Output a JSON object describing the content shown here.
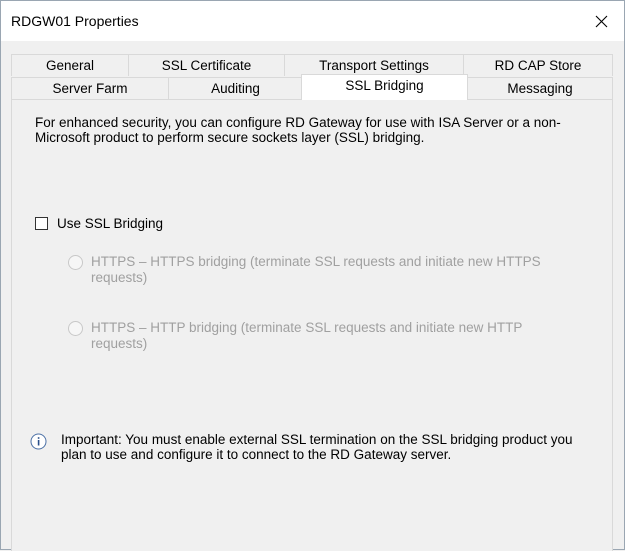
{
  "window": {
    "title": "RDGW01 Properties"
  },
  "tabs_back": [
    {
      "label": "General"
    },
    {
      "label": "SSL Certificate"
    },
    {
      "label": "Transport Settings"
    },
    {
      "label": "RD CAP Store"
    }
  ],
  "tabs_front": [
    {
      "label": "Server Farm"
    },
    {
      "label": "Auditing"
    },
    {
      "label": "SSL Bridging",
      "selected": true
    },
    {
      "label": "Messaging"
    }
  ],
  "panel": {
    "description": "For enhanced security, you can configure RD Gateway for use with ISA Server or a non-Microsoft product to perform secure sockets layer (SSL) bridging.",
    "use_ssl_bridging": {
      "label": "Use SSL Bridging",
      "checked": false
    },
    "options": [
      {
        "label": "HTTPS – HTTPS bridging (terminate SSL requests and initiate new HTTPS requests)",
        "enabled": false
      },
      {
        "label": "HTTPS – HTTP bridging (terminate SSL requests and initiate new HTTP requests)",
        "enabled": false
      }
    ],
    "info_text": "Important: You must enable external SSL termination on the SSL bridging product you plan to use and configure it to connect to the RD Gateway server."
  },
  "icons": {
    "close": "close-icon",
    "info": "info-icon"
  }
}
